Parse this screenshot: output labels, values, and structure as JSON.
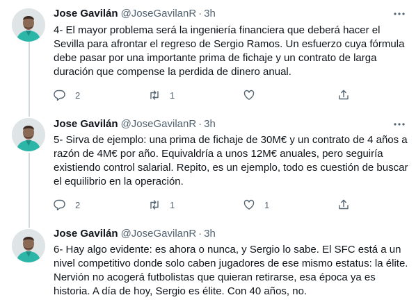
{
  "tweets": [
    {
      "author_name": "Jose Gavilán",
      "handle": "@JoseGavilanR",
      "separator": "·",
      "time": "3h",
      "text": "4- El mayor problema será la ingeniería financiera que deberá hacer el Sevilla para afrontar el regreso de Sergio Ramos. Un esfuerzo cuya fórmula debe pasar por una importante prima de fichaje y un contrato de larga duración que compense la perdida de dinero anual.",
      "replies": "2",
      "retweets": "1",
      "likes": ""
    },
    {
      "author_name": "Jose Gavilán",
      "handle": "@JoseGavilanR",
      "separator": "·",
      "time": "3h",
      "text": "5- Sirva de ejemplo: una prima de fichaje de 30M€ y un contrato de 4 años a razón de 4M€ por año. Equivaldría a unos 12M€ anuales, pero seguiría existiendo control salarial. Repito, es un ejemplo, todo es cuestión de buscar el equilibrio en la operación.",
      "replies": "2",
      "retweets": "1",
      "likes": "1"
    },
    {
      "author_name": "Jose Gavilán",
      "handle": "@JoseGavilanR",
      "separator": "·",
      "time": "3h",
      "text": "6- Hay algo evidente: es ahora o nunca, y Sergio lo sabe. El SFC está a un nivel competitivo donde solo caben jugadores de ese mismo estatus: la élite. Nervión no acogerá futbolistas que quieran retirarse, esa época ya es historia. A día de hoy, Sergio es élite. Con 40 años, no.",
      "replies": "",
      "retweets": "",
      "likes": ""
    }
  ],
  "icons": {
    "more": "more-horizontal-icon",
    "reply": "reply-icon",
    "retweet": "retweet-icon",
    "like": "like-icon",
    "share": "share-icon"
  },
  "colors": {
    "text": "#0f1419",
    "secondary": "#536471",
    "thread_line": "#cfd9de",
    "jersey": "#2bb6a8"
  }
}
